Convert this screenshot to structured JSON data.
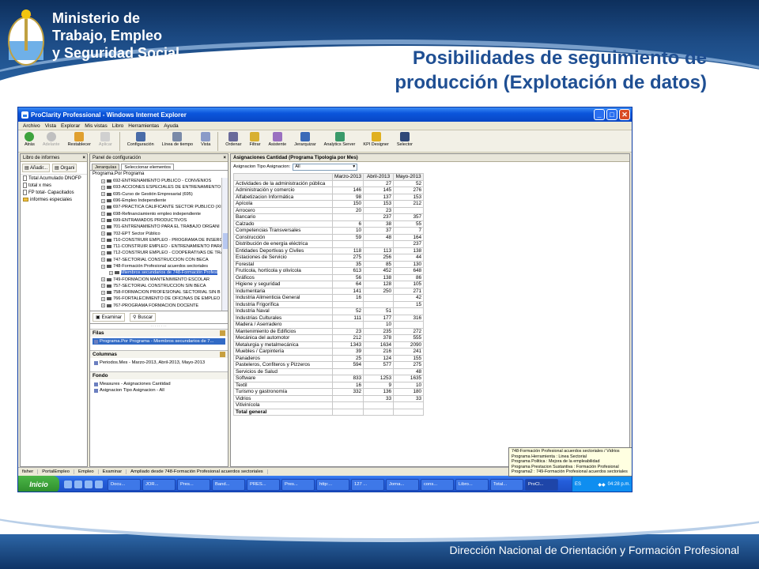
{
  "slide": {
    "org_line1": "Ministerio de",
    "org_line2": "Trabajo, Empleo",
    "org_line3": "y Seguridad Social",
    "title_line1": "Posibilidades de seguimiento de",
    "title_line2": "producción (Explotación de datos)",
    "footer": "Dirección Nacional de Orientación y Formación Profesional"
  },
  "window": {
    "title": "ProClarity Professional - Windows Internet Explorer",
    "menu": [
      "Archivo",
      "Vista",
      "Explorar",
      "Mis vistas",
      "Libro",
      "Herramientas",
      "Ayuda"
    ],
    "toolbar": [
      "Atrás",
      "Adelante",
      "Restablecer",
      "Aplicar",
      "Configuración",
      "Línea de tiempo",
      "Vista",
      "Ordenar",
      "Filtrar",
      "Asistente",
      "Jerarquizar",
      "Analytics Server",
      "KPI Designer",
      "Selector"
    ]
  },
  "left_panel": {
    "title": "Libro de informes",
    "add_button": "Añadir...",
    "org_button": "Organi",
    "items": [
      "Total Acumulado DNOFP",
      "total x mes",
      "FP total- Capacitados",
      "informes especiales"
    ]
  },
  "config_panel": {
    "title": "Panel de configuración",
    "tabs": [
      "Jerarquías",
      "Seleccionar elementos"
    ],
    "tree_header": "Programa.Por Programa",
    "tree": [
      "692-ENTRENAMIENTO PUBLICO - CONVENIOS",
      "693-ACCIONES ESPECIALES DE ENTRENAMIENTO (",
      "695-Curso de Gestión Empresarial (695)",
      "696-Empleo Independiente",
      "697-PRACTICA CALIFICANTE SECTOR PUBLICO (XI",
      "698-Refinanciamiento empleo independiente",
      "699-ENTRAMADOS PRODUCTIVOS",
      "701-ENTRENAMIENTO PARA EL TRABAJO ORGANI",
      "702-EPT Sector Público",
      "710-CONSTRUIR EMPLEO - PROGRAMA DE INSERC",
      "711-CONSTRUIR EMPLEO - ENTRENAMIENTO PARA",
      "712-CONSTRUIR EMPLEO - COOPERATIVAS DE TRA",
      "747-SECTORIAL CONSTRUCCION CON BECA",
      "748-Formación Profesional acuerdos sectoriales"
    ],
    "tree_selected": "Miembros secundarios de 748-Formación Profesi",
    "tree_after": [
      "749-FORMACION MANTENIMIENTO ESCOLAR",
      "757-SECTORIAL CONSTRUCCION SIN BECA",
      "758-FORMACION PROFESIONAL SECTORIAL SIN B",
      "766-FORTALECIMIENTO DE OFICINAS DE EMPLEO",
      "767-PROGRAMA FORMACION DOCENTE"
    ],
    "examinar": "Examinar",
    "buscar": "Buscar",
    "filas_label": "Filas",
    "filas_item": "Programa.Por Programa - Miembros secundarios de 7...",
    "columnas_label": "Columnas",
    "columnas_item": "Periodos.Mes - Marzo-2013, Abril-2013, Mayo-2013",
    "fondo_label": "Fondo",
    "fondo_items": [
      "Measures - Asignaciones Cantidad",
      "Asignacion Tipo Asignacion - All"
    ]
  },
  "data_panel": {
    "title": "Asignaciones Cantidad (Programa Tipologia por Mes)",
    "filter_label": "Asignacion Tipo Asignacion:",
    "filter_value": "All",
    "columns": [
      "Marzo-2013",
      "Abril-2013",
      "Mayo-2013"
    ],
    "rows": [
      [
        "Actividades de la administración pública",
        "",
        "27",
        "52"
      ],
      [
        "Administración y comercio",
        "146",
        "145",
        "276"
      ],
      [
        "Alfabetizacion Informática",
        "98",
        "137",
        "153"
      ],
      [
        "Apícola",
        "150",
        "153",
        "212"
      ],
      [
        "Arrocero",
        "20",
        "23",
        ""
      ],
      [
        "Bancario",
        "",
        "237",
        "357"
      ],
      [
        "Calzado",
        "6",
        "38",
        "55"
      ],
      [
        "Competencias Transversales",
        "10",
        "37",
        "7"
      ],
      [
        "Construcción",
        "59",
        "48",
        "164"
      ],
      [
        "Distribución de energía eléctrica",
        "",
        "",
        "237"
      ],
      [
        "Entidades Deportivas y Civiles",
        "118",
        "113",
        "138"
      ],
      [
        "Estaciones de Servicio",
        "275",
        "256",
        "44"
      ],
      [
        "Forestal",
        "35",
        "85",
        "130"
      ],
      [
        "Frutícola, hortícola y olivícola",
        "613",
        "452",
        "648"
      ],
      [
        "Gráficos",
        "56",
        "138",
        "86"
      ],
      [
        "Higiene y seguridad",
        "64",
        "128",
        "105"
      ],
      [
        "Indumentaria",
        "141",
        "250",
        "271"
      ],
      [
        "Industria Alimenticia General",
        "16",
        "",
        "42"
      ],
      [
        "Industria Frigorífica",
        "",
        "",
        "15"
      ],
      [
        "Industria Naval",
        "52",
        "51",
        ""
      ],
      [
        "Industrias Culturales",
        "111",
        "177",
        "316"
      ],
      [
        "Madera / Aserradero",
        "",
        "10",
        ""
      ],
      [
        "Mantenimiento de Edificios",
        "23",
        "235",
        "272"
      ],
      [
        "Mecánica del automotor",
        "212",
        "378",
        "555"
      ],
      [
        "Metalurgia y metalmecánica",
        "1343",
        "1634",
        "2090"
      ],
      [
        "Muebles / Carpintería",
        "39",
        "216",
        "241"
      ],
      [
        "Panaderos",
        "25",
        "124",
        "155"
      ],
      [
        "Pasteleros, Confiteros y Pizzeros",
        "594",
        "577",
        "275"
      ],
      [
        "Servicios de Salud",
        "",
        "",
        "48"
      ],
      [
        "Software",
        "833",
        "1253",
        "1635"
      ],
      [
        "Textil",
        "16",
        "9",
        "10"
      ],
      [
        "Turismo y gastronomía",
        "332",
        "136",
        "180"
      ],
      [
        "Vidrios",
        "",
        "33",
        "33"
      ],
      [
        "Vitivinícola",
        "",
        "",
        ""
      ],
      [
        "Total general",
        "",
        "",
        ""
      ]
    ],
    "tooltip": [
      "748-Formación Profesional acuerdos sectoriales / Vidrios",
      "Programa Herramienta : Linea Sectorial",
      "Programa Politica : Mejora de la empleabilidad",
      "Programa Prestacion Sustantiva : Formación Profesional",
      "Programa2 : 749-Formación Profesional acuerdos sectoriales"
    ]
  },
  "status": [
    "fisher",
    "PortalEmpleo",
    "Empleo",
    "Examinar",
    "Ampliado desde 748-Formación Profesional acuerdos sectoriales"
  ],
  "taskbar": {
    "start": "Inicio",
    "tasks": [
      "Docu...",
      "JOR...",
      "Pres...",
      "Band...",
      "PRES...",
      "Pres...",
      "http:...",
      "127 ...",
      "Jorna...",
      "cons...",
      "Libro...",
      "Total...",
      "ProCl..."
    ],
    "lang": "ES",
    "clock": "04:28 p.m."
  }
}
